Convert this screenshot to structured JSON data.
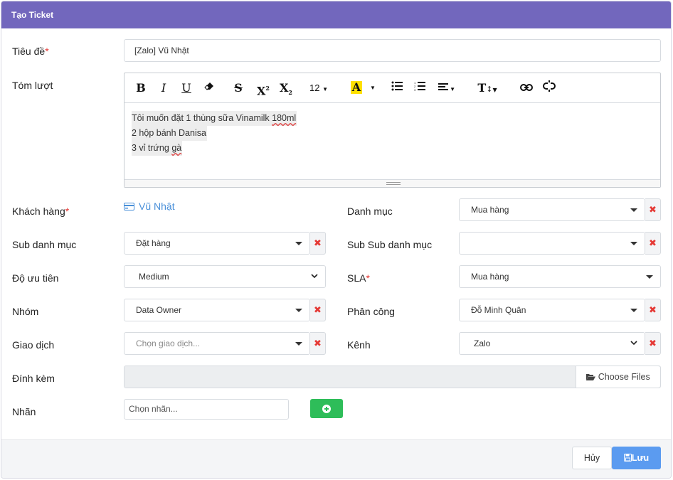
{
  "modal": {
    "title": "Tạo Ticket"
  },
  "labels": {
    "title": "Tiêu đề",
    "summary": "Tóm lượt",
    "customer": "Khách hàng",
    "category": "Danh mục",
    "sub_category": "Sub danh mục",
    "sub_sub_category": "Sub Sub danh mục",
    "priority": "Độ ưu tiên",
    "sla": "SLA",
    "group": "Nhóm",
    "assignee": "Phân công",
    "transaction": "Giao dịch",
    "channel": "Kênh",
    "attachment": "Đính kèm",
    "tags": "Nhãn",
    "required_mark": "*"
  },
  "fields": {
    "title_value": "[Zalo] Vũ Nhật",
    "customer_name": "Vũ Nhật",
    "category": "Mua hàng",
    "sub_category": "Đặt hàng",
    "sub_sub_category": "",
    "priority": "Medium",
    "sla": "Mua hàng",
    "group": "Data Owner",
    "assignee": "Đỗ Minh Quân",
    "transaction_placeholder": "Chọn giao dịch...",
    "channel": "Zalo",
    "choose_files": "Choose Files",
    "tags_placeholder": "Chọn nhãn..."
  },
  "editor": {
    "font_size": "12",
    "lines": {
      "l1_pre": "Tôi muốn đặt 1 thùng sữa Vinamilk ",
      "l1_err": "180ml",
      "l2": "2 hộp bánh Danisa",
      "l3_pre": "3 vỉ trứng ",
      "l3_err": "gà"
    }
  },
  "footer": {
    "cancel": "Hủy",
    "save": "Lưu"
  },
  "colors": {
    "header": "#7267bd",
    "save": "#5b9bf0",
    "add": "#2ebd59",
    "remove": "#e53935",
    "link": "#4a90d9"
  }
}
